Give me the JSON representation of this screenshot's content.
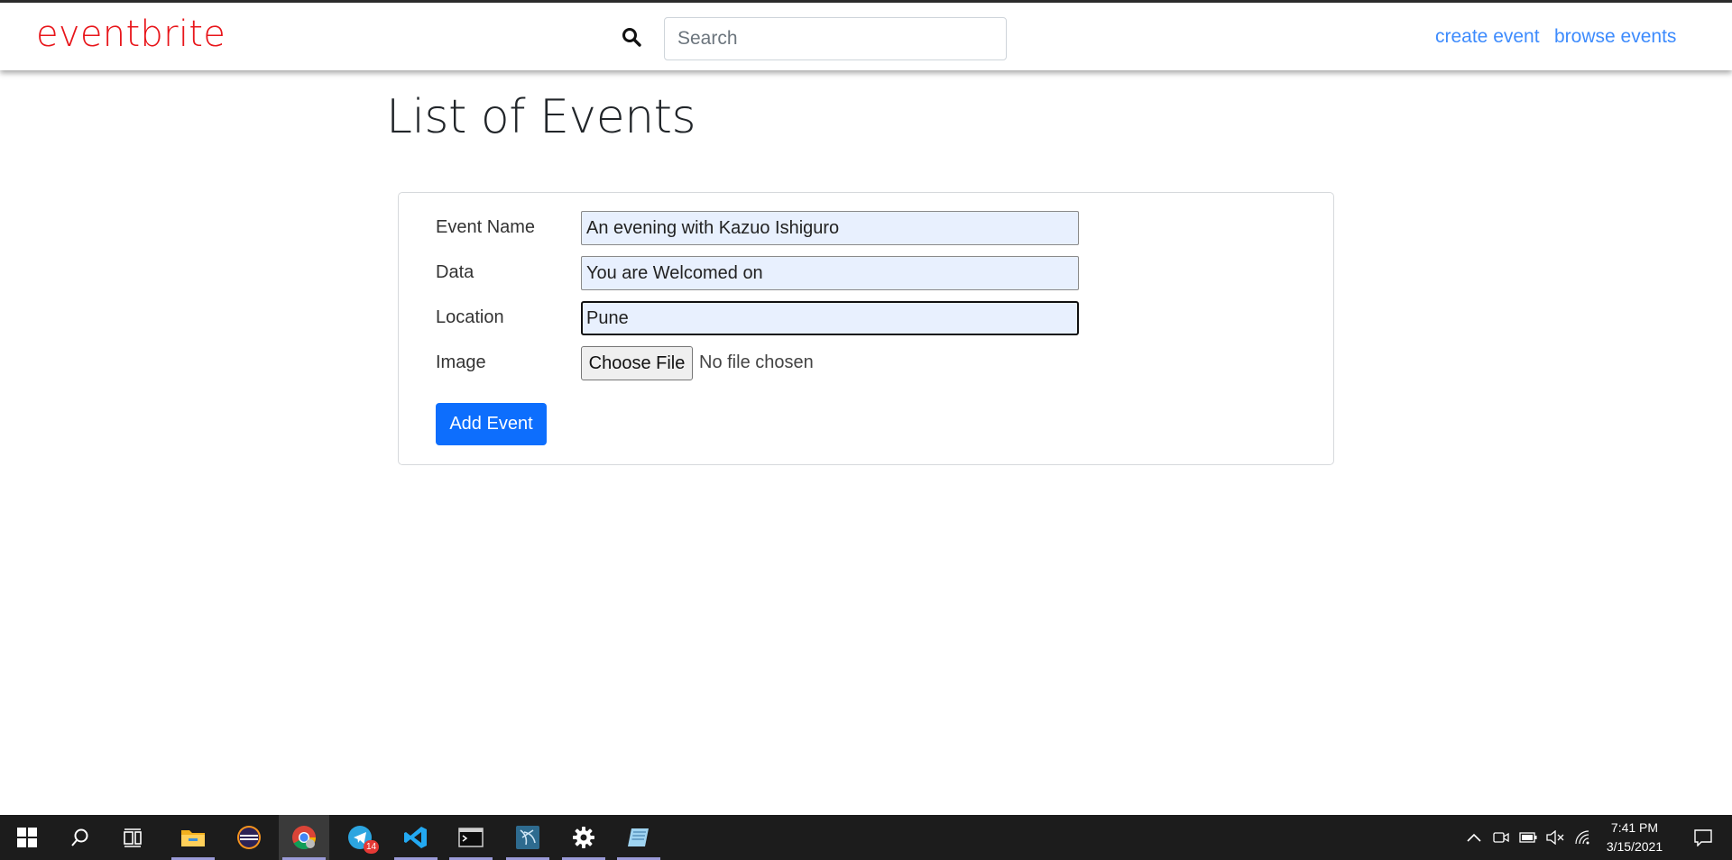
{
  "navbar": {
    "brand": "eventbrite",
    "search_placeholder": "Search",
    "links": [
      "create event",
      "browse events"
    ]
  },
  "page": {
    "title": "List of Events"
  },
  "form": {
    "fields": [
      {
        "label": "Event Name",
        "value": "An evening with Kazuo Ishiguro"
      },
      {
        "label": "Data",
        "value": "You are Welcomed on"
      },
      {
        "label": "Location",
        "value": "Pune"
      }
    ],
    "image": {
      "label": "Image",
      "button": "Choose File",
      "status": "No file chosen"
    },
    "submit": "Add Event"
  },
  "taskbar": {
    "apps": [
      "start-icon",
      "search-icon",
      "task-view-icon",
      "file-explorer-icon",
      "eclipse-icon",
      "chrome-icon",
      "telegram-icon",
      "vscode-icon",
      "terminal-icon",
      "mysql-workbench-icon",
      "settings-icon",
      "notepad-icon"
    ],
    "telegram_badge": "14",
    "time": "7:41 PM",
    "date": "3/15/2021"
  },
  "colors": {
    "brand": "#e8161b",
    "link": "#3d8bfd",
    "primary": "#0d6efd",
    "autofill": "#e8f0fe",
    "taskbar": "#1c1c1c"
  }
}
